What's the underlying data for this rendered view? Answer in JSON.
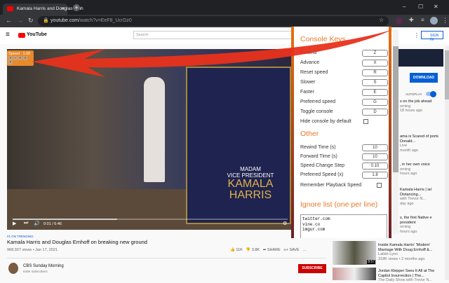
{
  "browser": {
    "tab_title": "Kamala Harris and Douglas Emh",
    "url_host": "youtube.com",
    "url_path": "/watch?v=EeF8_UcrDz0"
  },
  "youtube": {
    "logo": "YouTube",
    "search_placeholder": "Search",
    "sign_in": "SIGN IN"
  },
  "video": {
    "speed_label": "Speed : 1.00",
    "speed_buttons": [
      "«",
      "−",
      "+",
      "»",
      "×"
    ],
    "time": "0:01 / 6:46",
    "progress": 0.38,
    "overlay_text": [
      "MADAM",
      "VICE PRESIDENT",
      "KAMALA",
      "HARRIS"
    ]
  },
  "info": {
    "trending": "#1 ON TRENDING",
    "title": "Kamala Harris and Douglas Emhoff on breaking new ground",
    "views": "968,937 views • Jan 17, 2021",
    "likes": "11K",
    "dislikes": "3.8K",
    "share": "SHARE",
    "save": "SAVE",
    "channel": "CBS Sunday Morning",
    "subscribers": "640K subscribers",
    "subscribe": "SUBSCRIBE"
  },
  "console": {
    "keys_title": "Console Keys",
    "keys": [
      {
        "label": "Rewind",
        "key": "Z"
      },
      {
        "label": "Advance",
        "key": "X"
      },
      {
        "label": "Reset speed",
        "key": "R"
      },
      {
        "label": "Slower",
        "key": "S"
      },
      {
        "label": "Faster",
        "key": "E"
      },
      {
        "label": "Preferred speed",
        "key": "G"
      },
      {
        "label": "Toggle console",
        "key": "D"
      }
    ],
    "hide_label": "Hide console by default",
    "other_title": "Other",
    "other": [
      {
        "label": "Rewind Time (s)",
        "value": "10"
      },
      {
        "label": "Forward Time (s)",
        "value": "10"
      },
      {
        "label": "Speed Change Step",
        "value": "0.10"
      },
      {
        "label": "Preferred Speed (x)",
        "value": "1.8"
      }
    ],
    "remember_label": "Remember Playback Speed",
    "ignore_title": "Ignore list (one per line)",
    "ignore_list": "twitter.com\nvine.co\nimgur.com"
  },
  "sidebar": {
    "download": "DOWNLOAD",
    "autoplay": "AUTOPLAY",
    "items": [
      {
        "title": "s on the job ahead",
        "meta": "orning",
        "age": "18 hours ago"
      },
      {
        "title": "ama is Scared of ports Donald...",
        "meta": "Live",
        "age": "month ago"
      },
      {
        "title": ", in her own voice",
        "meta": "orning",
        "age": "hours ago"
      },
      {
        "title": "Kamala Harris | ial Distancing...",
        "meta": "with Trevor N...",
        "age": "day ago"
      },
      {
        "title": "s, the first Native e president",
        "meta": "orning",
        "age": "hours ago"
      },
      {
        "title": "Inside Kamala Harris' 'Modern' Marriage With Doug Emhoff &...",
        "meta": "Lailah Lynn",
        "age": "318K views • 2 months ago",
        "duration": "8:57"
      },
      {
        "title": "Jordan Klepper Sees It All at The Capitol Insurrection | The...",
        "meta": "The Daily Show with Trevor N..."
      }
    ]
  }
}
